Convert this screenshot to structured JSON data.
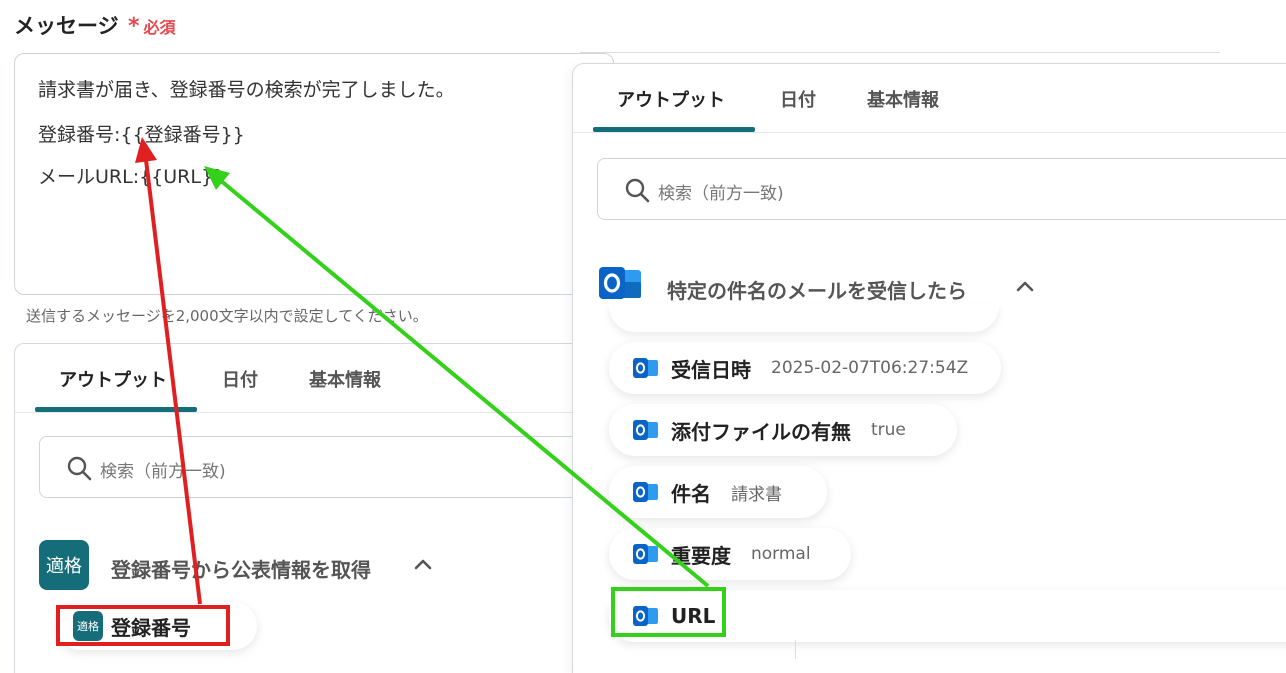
{
  "field": {
    "label": "メッセージ",
    "required_mark": "*",
    "required_text": "必須"
  },
  "message": {
    "lines": [
      "請求書が届き、登録番号の検索が完了しました。",
      "登録番号:{{登録番号}}",
      "メールURL:{{URL}}"
    ],
    "helper": "送信するメッセージを2,000文字以内で設定してください。"
  },
  "left_panel": {
    "tabs": [
      "アウトプット",
      "日付",
      "基本情報"
    ],
    "search_placeholder": "検索（前方一致)",
    "group": {
      "badge": "適格",
      "title": "登録番号から公表情報を取得",
      "chevron": "⌃"
    },
    "items": [
      {
        "badge": "適格",
        "name": "登録番号"
      }
    ]
  },
  "right_panel": {
    "tabs": [
      "アウトプット",
      "日付",
      "基本情報"
    ],
    "search_placeholder": "検索（前方一致)",
    "group": {
      "icon": "outlook-icon",
      "title": "特定の件名のメールを受信したら",
      "chevron": "⌃"
    },
    "items": [
      {
        "name": "受信日時",
        "value": "2025-02-07T06:27:54Z"
      },
      {
        "name": "添付ファイルの有無",
        "value": "true"
      },
      {
        "name": "件名",
        "value": "請求書"
      },
      {
        "name": "重要度",
        "value": "normal"
      },
      {
        "name": "URL",
        "value": ""
      }
    ]
  },
  "colors": {
    "accent": "#156d7a",
    "required": "#e5484d",
    "arrow_red": "#e02020",
    "arrow_green": "#33d11a",
    "outlook": "#0a64c8"
  }
}
